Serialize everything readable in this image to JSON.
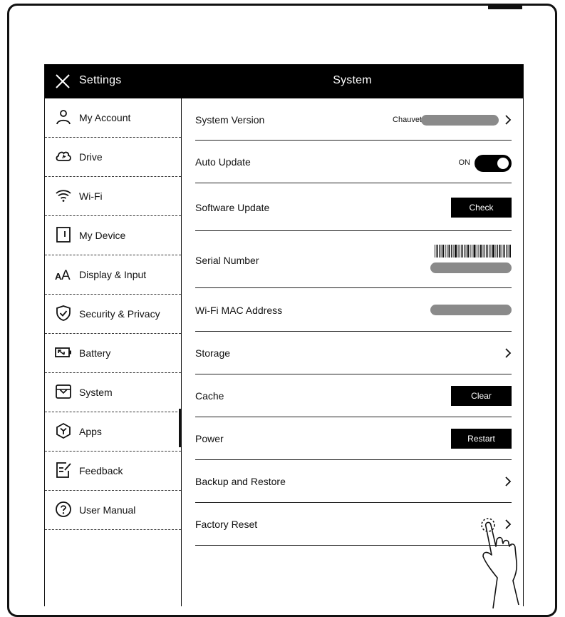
{
  "header": {
    "settings_title": "Settings",
    "page_title": "System"
  },
  "sidebar": {
    "items": [
      {
        "label": "My Account",
        "icon": "user-icon"
      },
      {
        "label": "Drive",
        "icon": "cloud-icon"
      },
      {
        "label": "Wi-Fi",
        "icon": "wifi-icon"
      },
      {
        "label": "My Device",
        "icon": "device-icon"
      },
      {
        "label": "Display & Input",
        "icon": "font-size-icon"
      },
      {
        "label": "Security & Privacy",
        "icon": "shield-icon"
      },
      {
        "label": "Battery",
        "icon": "battery-icon"
      },
      {
        "label": "System",
        "icon": "system-icon",
        "active": true
      },
      {
        "label": "Apps",
        "icon": "apps-icon"
      },
      {
        "label": "Feedback",
        "icon": "feedback-icon"
      },
      {
        "label": "User Manual",
        "icon": "help-icon"
      }
    ]
  },
  "main": {
    "system_version": {
      "label": "System Version",
      "value_prefix": "Chauvet"
    },
    "auto_update": {
      "label": "Auto Update",
      "state": "ON"
    },
    "software_update": {
      "label": "Software Update",
      "button": "Check"
    },
    "serial_number": {
      "label": "Serial Number"
    },
    "wifi_mac": {
      "label": "Wi-Fi MAC Address"
    },
    "storage": {
      "label": "Storage"
    },
    "cache": {
      "label": "Cache",
      "button": "Clear"
    },
    "power": {
      "label": "Power",
      "button": "Restart"
    },
    "backup": {
      "label": "Backup and Restore"
    },
    "factory_reset": {
      "label": "Factory Reset"
    }
  },
  "colors": {
    "titlebar": "#000000",
    "redaction": "#8a8a8a",
    "button": "#000000"
  }
}
